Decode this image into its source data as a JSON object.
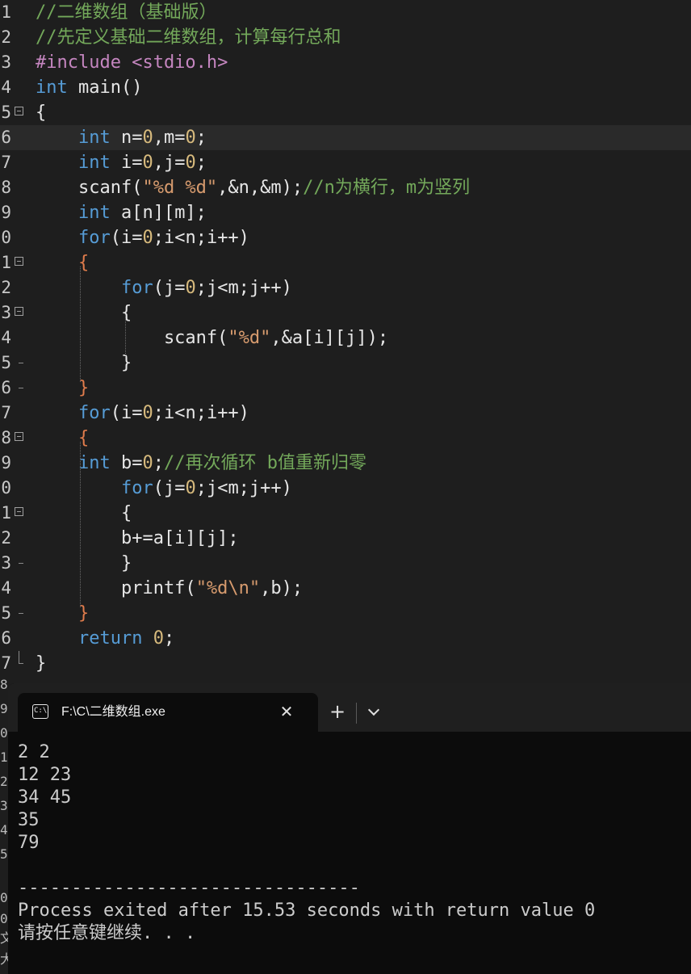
{
  "editor": {
    "lines": [
      {
        "n": "1",
        "tokens": [
          [
            "c-comment",
            "//二维数组（基础版）"
          ]
        ]
      },
      {
        "n": "2",
        "tokens": [
          [
            "c-comment",
            "//先定义基础二维数组，计算每行总和"
          ]
        ]
      },
      {
        "n": "3",
        "tokens": [
          [
            "c-pre",
            "#include <stdio.h>"
          ]
        ]
      },
      {
        "n": "4",
        "tokens": [
          [
            "c-kw",
            "int"
          ],
          [
            "c-op",
            " main()"
          ]
        ]
      },
      {
        "n": "5",
        "tokens": [
          [
            "c-op",
            "{"
          ]
        ]
      },
      {
        "n": "6",
        "tokens": [
          [
            "c-kw",
            "    int"
          ],
          [
            "c-op",
            " n="
          ],
          [
            "c-num",
            "0"
          ],
          [
            "c-op",
            ",m="
          ],
          [
            "c-num",
            "0"
          ],
          [
            "c-op",
            ";"
          ]
        ]
      },
      {
        "n": "7",
        "tokens": [
          [
            "c-kw",
            "    int"
          ],
          [
            "c-op",
            " i="
          ],
          [
            "c-num",
            "0"
          ],
          [
            "c-op",
            ",j="
          ],
          [
            "c-num",
            "0"
          ],
          [
            "c-op",
            ";"
          ]
        ]
      },
      {
        "n": "8",
        "tokens": [
          [
            "c-op",
            "    scanf("
          ],
          [
            "c-str",
            "\"%d %d\""
          ],
          [
            "c-op",
            ",&n,&m);"
          ],
          [
            "c-comment",
            "//n为横行，m为竖列"
          ]
        ]
      },
      {
        "n": "9",
        "tokens": [
          [
            "c-kw",
            "    int"
          ],
          [
            "c-op",
            " a[n][m];"
          ]
        ]
      },
      {
        "n": "0",
        "tokens": [
          [
            "c-kw",
            "    for"
          ],
          [
            "c-op",
            "(i="
          ],
          [
            "c-num",
            "0"
          ],
          [
            "c-op",
            ";i<n;i++)"
          ]
        ]
      },
      {
        "n": "1",
        "tokens": [
          [
            "c-brace",
            "    {"
          ]
        ]
      },
      {
        "n": "2",
        "tokens": [
          [
            "c-kw",
            "        for"
          ],
          [
            "c-op",
            "(j="
          ],
          [
            "c-num",
            "0"
          ],
          [
            "c-op",
            ";j<m;j++)"
          ]
        ]
      },
      {
        "n": "3",
        "tokens": [
          [
            "c-op",
            "        {"
          ]
        ]
      },
      {
        "n": "4",
        "tokens": [
          [
            "c-op",
            "            scanf("
          ],
          [
            "c-str",
            "\"%d\""
          ],
          [
            "c-op",
            ",&a[i][j]);"
          ]
        ]
      },
      {
        "n": "5",
        "tokens": [
          [
            "c-op",
            "        }"
          ]
        ]
      },
      {
        "n": "6",
        "tokens": [
          [
            "c-brace",
            "    }"
          ]
        ]
      },
      {
        "n": "7",
        "tokens": [
          [
            "c-kw",
            "    for"
          ],
          [
            "c-op",
            "(i="
          ],
          [
            "c-num",
            "0"
          ],
          [
            "c-op",
            ";i<n;i++)"
          ]
        ]
      },
      {
        "n": "8",
        "tokens": [
          [
            "c-brace",
            "    {"
          ]
        ]
      },
      {
        "n": "9",
        "tokens": [
          [
            "c-kw",
            "    int"
          ],
          [
            "c-op",
            " b="
          ],
          [
            "c-num",
            "0"
          ],
          [
            "c-op",
            ";"
          ],
          [
            "c-comment",
            "//再次循环 b值重新归零"
          ]
        ]
      },
      {
        "n": "0",
        "tokens": [
          [
            "c-kw",
            "        for"
          ],
          [
            "c-op",
            "(j="
          ],
          [
            "c-num",
            "0"
          ],
          [
            "c-op",
            ";j<m;j++)"
          ]
        ]
      },
      {
        "n": "1",
        "tokens": [
          [
            "c-op",
            "        {"
          ]
        ]
      },
      {
        "n": "2",
        "tokens": [
          [
            "c-op",
            "        b+=a[i][j];"
          ]
        ]
      },
      {
        "n": "3",
        "tokens": [
          [
            "c-op",
            "        }"
          ]
        ]
      },
      {
        "n": "4",
        "tokens": [
          [
            "c-op",
            "        printf("
          ],
          [
            "c-str",
            "\"%d\\n\""
          ],
          [
            "c-op",
            ",b);"
          ]
        ]
      },
      {
        "n": "5",
        "tokens": [
          [
            "c-brace",
            "    }"
          ]
        ]
      },
      {
        "n": "6",
        "tokens": [
          [
            "c-kw",
            "    return"
          ],
          [
            "c-op",
            " "
          ],
          [
            "c-num",
            "0"
          ],
          [
            "c-op",
            ";"
          ]
        ]
      },
      {
        "n": "7",
        "tokens": [
          [
            "c-op",
            "}"
          ]
        ]
      }
    ],
    "current_line": 6
  },
  "terminal": {
    "tab_icon": "C:\\",
    "tab_title": "F:\\C\\二维数组.exe",
    "close_glyph": "✕",
    "new_tab_glyph": "+",
    "output": [
      "2 2",
      "12 23",
      "34 45",
      "35",
      "79",
      "",
      "--------------------------------",
      "Process exited after 15.53 seconds with return value 0",
      "请按任意键继续. . ."
    ]
  },
  "hidden_edge": {
    "fragments": [
      "8",
      "9",
      "0",
      "1",
      "2",
      "3",
      "4",
      "5",
      "0",
      "0",
      "文",
      "大"
    ]
  }
}
